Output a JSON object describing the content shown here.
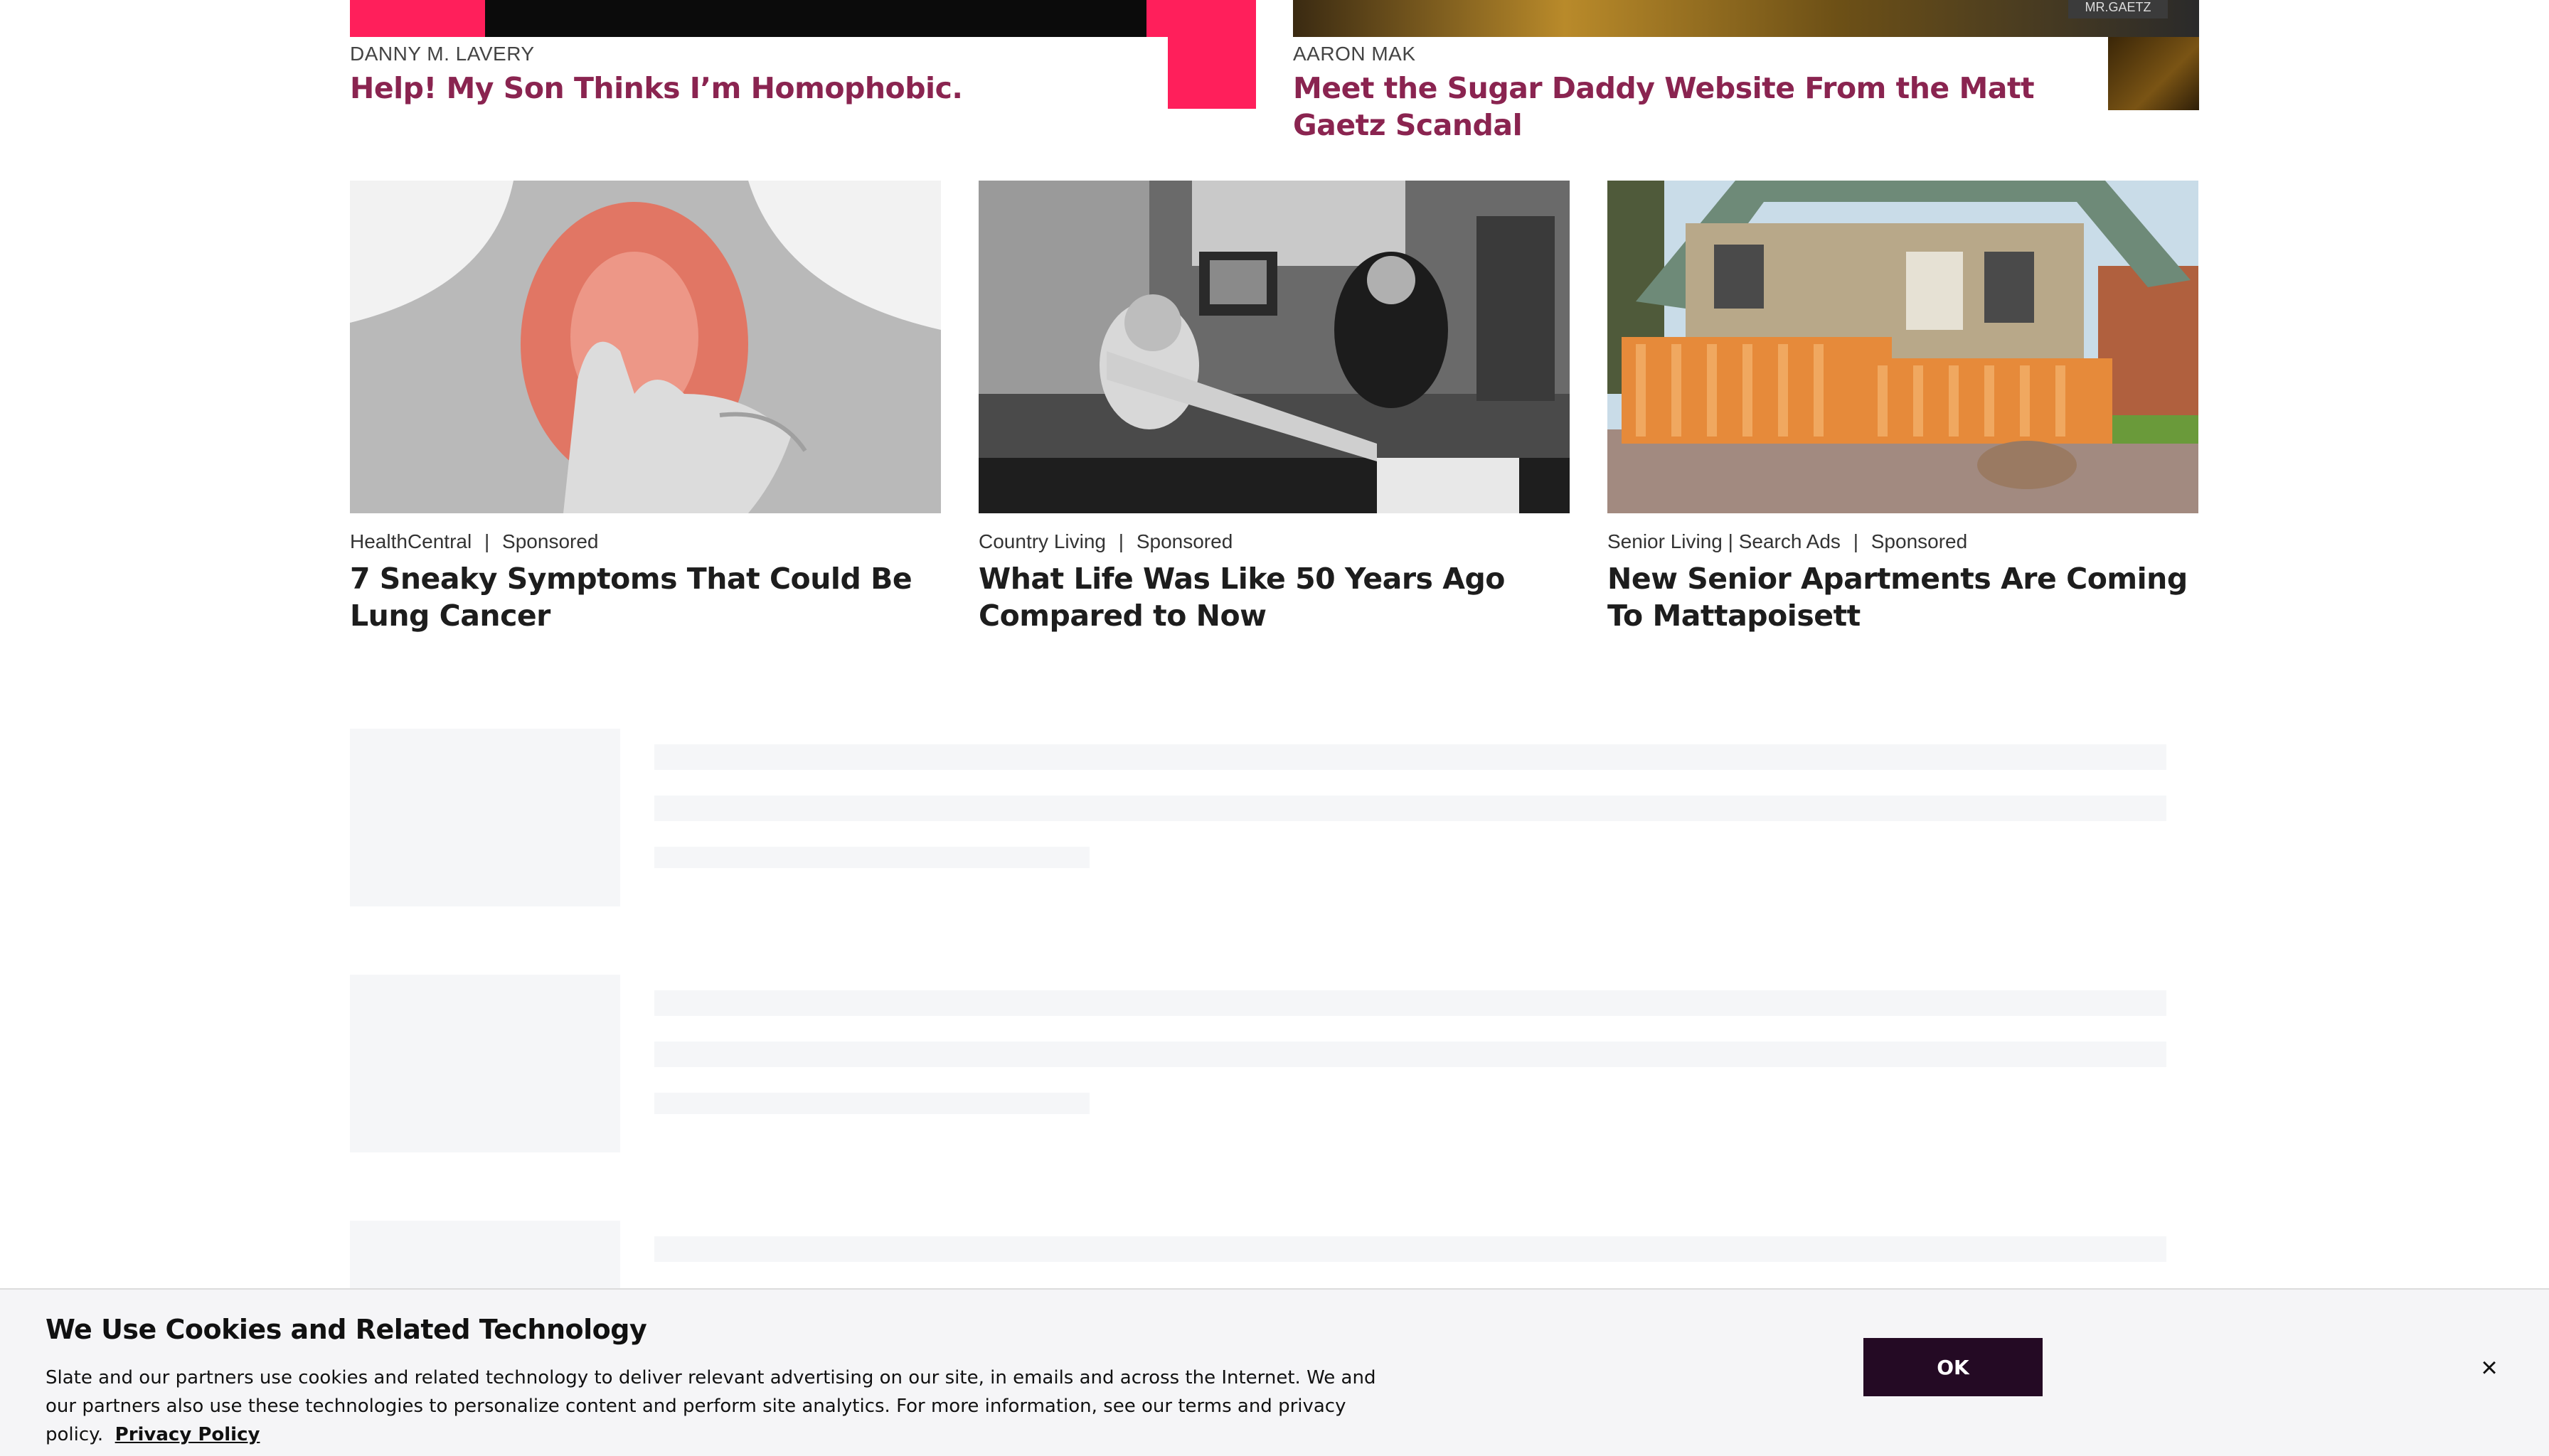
{
  "top_stories": [
    {
      "author": "DANNY M. LAVERY",
      "headline": "Help! My Son Thinks I’m Homophobic."
    },
    {
      "author": "AARON MAK",
      "headline": "Meet the Sugar Daddy Website From the Matt Gaetz Scandal",
      "image_sign": "MR.GAETZ"
    }
  ],
  "sponsored": [
    {
      "source": "HealthCentral",
      "label": "Sponsored",
      "headline": "7 Sneaky Symptoms That Could Be Lung Cancer"
    },
    {
      "source": "Country Living",
      "label": "Sponsored",
      "headline": "What Life Was Like 50 Years Ago Compared to Now"
    },
    {
      "source": "Senior Living | Search Ads",
      "label": "Sponsored",
      "headline": "New Senior Apartments Are Coming To Mattapoisett"
    }
  ],
  "separator": "|",
  "cookie_banner": {
    "title": "We Use Cookies and Related Technology",
    "text": "Slate and our partners use cookies and related technology to deliver relevant advertising on our site, in emails and across the Internet. We and our partners also use these technologies to personalize content and perform site analytics. For more information, see our terms and privacy policy.",
    "link": "Privacy Policy",
    "ok_label": "OK",
    "close_glyph": "×"
  }
}
